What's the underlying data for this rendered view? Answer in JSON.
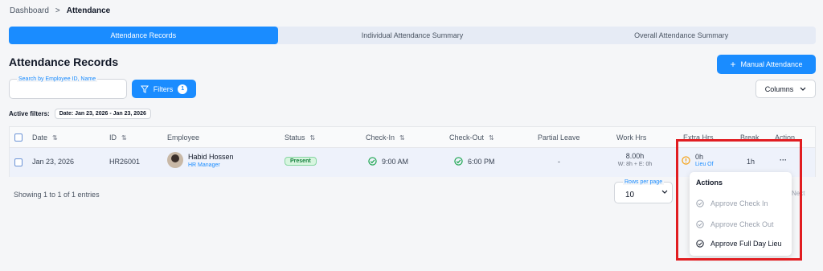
{
  "breadcrumb": {
    "parent": "Dashboard",
    "separator": ">",
    "current": "Attendance"
  },
  "tabs": [
    {
      "label": "Attendance Records"
    },
    {
      "label": "Individual Attendance Summary"
    },
    {
      "label": "Overall Attendance Summary"
    }
  ],
  "page_title": "Attendance Records",
  "toolbar": {
    "manual_attendance_label": "Manual Attendance",
    "search_placeholder": "Search by Employee ID, Name",
    "filters_label": "Filters",
    "filters_count": "1",
    "columns_label": "Columns"
  },
  "active_filters": {
    "label": "Active filters:",
    "chip": "Date: Jan 23, 2026 - Jan 23, 2026"
  },
  "table": {
    "columns": [
      "Date",
      "ID",
      "Employee",
      "Status",
      "Check-In",
      "Check-Out",
      "Partial Leave",
      "Work Hrs",
      "Extra Hrs",
      "Break",
      "Action"
    ],
    "rows": [
      {
        "date": "Jan 23, 2026",
        "id": "HR26001",
        "employee_name": "Habid Hossen",
        "employee_role": "HR Manager",
        "status": "Present",
        "check_in": "9:00 AM",
        "check_out": "6:00 PM",
        "partial_leave": "-",
        "work_hrs": "8.00h",
        "work_hrs_detail": "W: 8h + E: 0h",
        "extra_hrs": "0h",
        "extra_hrs_note": "Lieu Of",
        "break": "1h",
        "action": "···"
      }
    ]
  },
  "actions_menu": {
    "title": "Actions",
    "items": [
      {
        "label": "Approve Check In",
        "enabled": false
      },
      {
        "label": "Approve Check Out",
        "enabled": false
      },
      {
        "label": "Approve Full Day Lieu",
        "enabled": true
      }
    ]
  },
  "pagination": {
    "showing": "Showing 1 to 1 of 1 entries",
    "rows_per_page_label": "Rows per page",
    "rows_per_page_value": "10",
    "next_label": "Next"
  },
  "colors": {
    "accent": "#1a8cff",
    "present": "#15803d",
    "highlight": "#e11d21"
  }
}
